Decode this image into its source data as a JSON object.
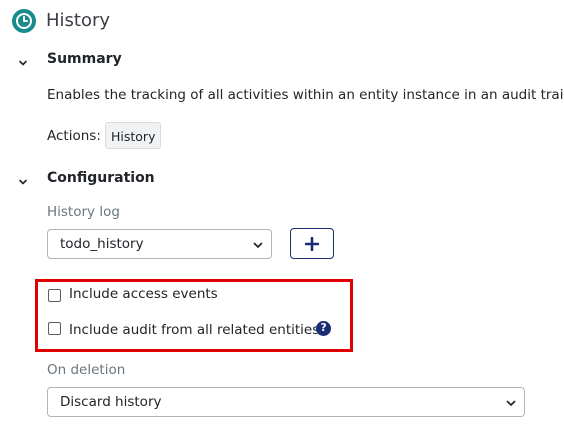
{
  "header": {
    "title": "History",
    "icon": "clock-icon",
    "accent_color": "#1a8b8c"
  },
  "summary": {
    "title": "Summary",
    "description": "Enables the tracking of all activities within an entity instance in an audit trail.",
    "actions_label": "Actions:",
    "actions": [
      "History"
    ]
  },
  "configuration": {
    "title": "Configuration",
    "history_log": {
      "label": "History log",
      "value": "todo_history"
    },
    "add_button_icon": "plus-icon",
    "include_access_events": {
      "label": "Include access events",
      "checked": false
    },
    "include_audit_related": {
      "label": "Include audit from all related entities",
      "checked": false,
      "help_text": "?"
    },
    "on_deletion": {
      "label": "On deletion",
      "value": "Discard history"
    }
  }
}
